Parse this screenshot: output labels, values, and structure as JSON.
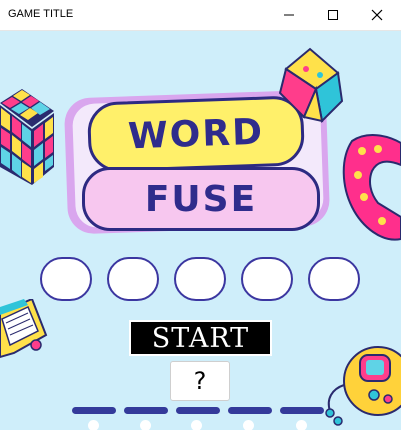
{
  "window": {
    "title": "GAME TITLE",
    "minimize_icon": "minimize-icon",
    "maximize_icon": "maximize-icon",
    "close_icon": "close-icon"
  },
  "logo": {
    "line1": "WORD",
    "line2": "FUSE"
  },
  "letter_slots": [
    "",
    "",
    "",
    "",
    ""
  ],
  "buttons": {
    "start_label": "START",
    "help_label": "?"
  },
  "decorations": [
    "rubiks-cube-icon",
    "paper-fortune-teller-icon",
    "phone-handset-icon",
    "cassette-tape-icon",
    "handheld-game-icon"
  ],
  "colors": {
    "background": "#cfeefa",
    "logo_yellow": "#fff06a",
    "logo_pink": "#f7c7ef",
    "logo_text": "#2f2c8c",
    "slot_border": "#3b36a0"
  }
}
